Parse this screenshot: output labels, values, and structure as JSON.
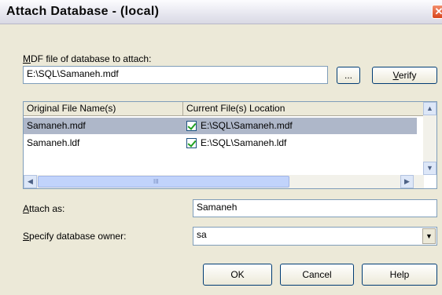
{
  "window": {
    "title": "Attach Database - (local)",
    "close_glyph": "✕"
  },
  "mdf": {
    "label_prefix": "M",
    "label_rest": "DF file of database to attach:",
    "value": "E:\\SQL\\Samaneh.mdf",
    "browse_label": "...",
    "verify_prefix": "V",
    "verify_rest": "erify"
  },
  "files": {
    "columns": [
      "Original File Name(s)",
      "Current File(s) Location"
    ],
    "rows": [
      {
        "original": "Samaneh.mdf",
        "checked": true,
        "location": "E:\\SQL\\Samaneh.mdf",
        "selected": true
      },
      {
        "original": "Samaneh.ldf",
        "checked": true,
        "location": "E:\\SQL\\Samaneh.ldf",
        "selected": false
      }
    ],
    "hscroll_grip": "III"
  },
  "attach_as": {
    "label_prefix": "A",
    "label_rest": "ttach as:",
    "value": "Samaneh"
  },
  "owner": {
    "label_prefix": "S",
    "label_rest": "pecify database owner:",
    "value": "sa"
  },
  "buttons": {
    "ok": "OK",
    "cancel": "Cancel",
    "help": "Help"
  }
}
